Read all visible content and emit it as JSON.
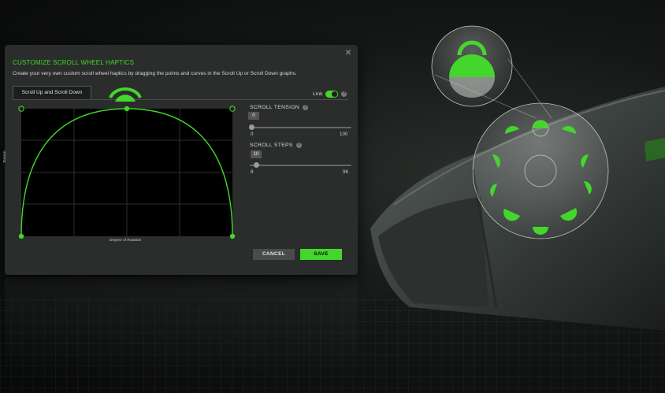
{
  "dialog": {
    "title": "CUSTOMIZE SCROLL WHEEL HAPTICS",
    "description": "Create your very own custom scroll wheel haptics by dragging the points and curves in the Scroll Up or Scroll Down graphs.",
    "close_icon": "close-icon",
    "tab_label": "Scroll Up and Scroll Down",
    "link_label": "Link",
    "link_on": true,
    "graph": {
      "y_label": "Tension",
      "x_label": "Degree of Rotation"
    },
    "scroll_tension": {
      "label": "SCROLL TENSION",
      "value": "0",
      "min": "0",
      "max": "100"
    },
    "scroll_steps": {
      "label": "SCROLL STEPS",
      "value": "10",
      "min": "8",
      "max": "96"
    },
    "cancel_label": "CANCEL",
    "save_label": "SAVE"
  },
  "colors": {
    "accent": "#44d62c",
    "panel": "#2a2d2b"
  }
}
